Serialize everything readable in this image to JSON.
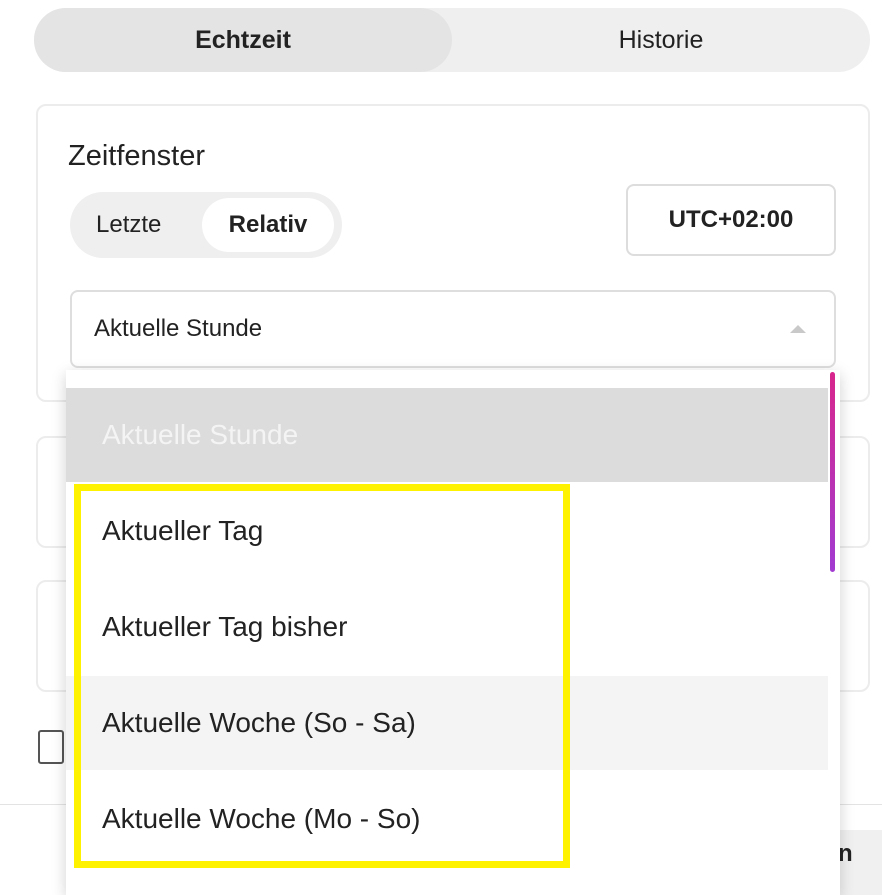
{
  "tabs": [
    {
      "label": "Echtzeit",
      "active": true
    },
    {
      "label": "Historie",
      "active": false
    }
  ],
  "section": {
    "title": "Zeitfenster"
  },
  "mode_toggle": {
    "options": [
      "Letzte",
      "Relativ"
    ],
    "selected": "Relativ"
  },
  "timezone": {
    "label": "UTC+02:00"
  },
  "select": {
    "value": "Aktuelle Stunde"
  },
  "dropdown": {
    "options": [
      {
        "label": "Aktuelle Stunde",
        "selected": true
      },
      {
        "label": "Aktueller Tag"
      },
      {
        "label": "Aktueller Tag bisher"
      },
      {
        "label": "Aktuelle Woche (So - Sa)",
        "hovered": true
      },
      {
        "label": "Aktuelle Woche (Mo - So)"
      }
    ]
  },
  "footer": {
    "button_label_partial": "n"
  },
  "colors": {
    "highlight": "#fff200",
    "scrollbar_top": "#d8268c",
    "scrollbar_bottom": "#a13bd1",
    "tab_bg": "#efefef",
    "selected_option_bg": "#dcdcdc"
  }
}
